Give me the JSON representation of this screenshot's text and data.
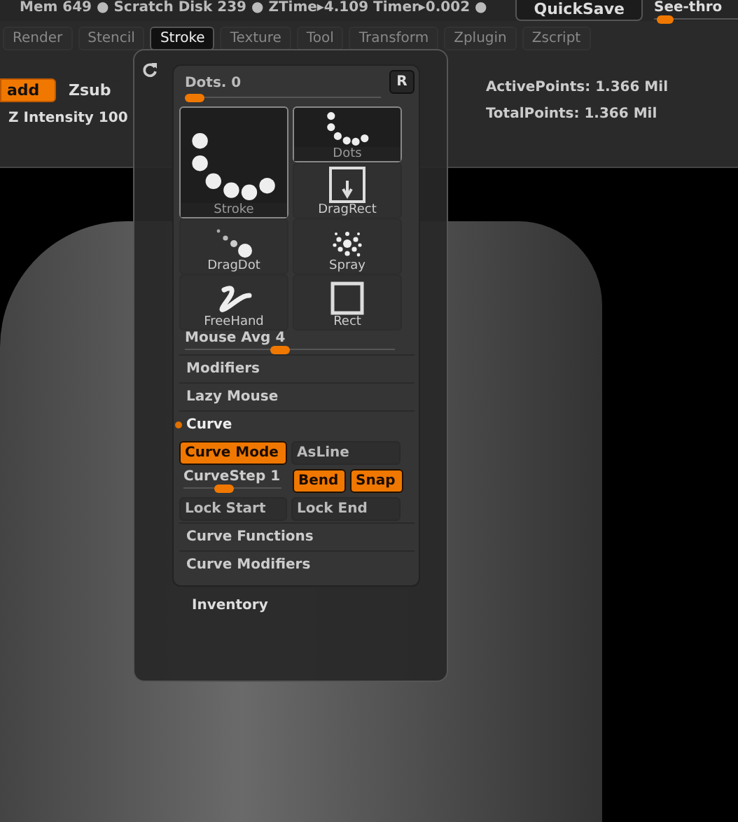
{
  "status_bar": {
    "text": "Mem 649 ● Scratch Disk 239 ●  ZTime▸4.109 Timer▸0.002 ●",
    "quicksave": "QuickSave",
    "see_through": {
      "label": "See-thro",
      "level": 0.05
    }
  },
  "tabs": [
    {
      "label": "Render",
      "selected": false
    },
    {
      "label": "Stencil",
      "selected": false
    },
    {
      "label": "Stroke",
      "selected": true
    },
    {
      "label": "Texture",
      "selected": false
    },
    {
      "label": "Tool",
      "selected": false
    },
    {
      "label": "Transform",
      "selected": false
    },
    {
      "label": "Zplugin",
      "selected": false
    },
    {
      "label": "Zscript",
      "selected": false
    }
  ],
  "toolbar": {
    "modes": [
      {
        "label": "add",
        "selected": true
      },
      {
        "label": "Zsub",
        "selected": false
      }
    ],
    "z_intensity": {
      "label": "Z Intensity 100"
    }
  },
  "stats": [
    "ActivePoints: 1.366 Mil",
    "TotalPoints: 1.366 Mil"
  ],
  "stroke_palette": {
    "title": "Dots. 0",
    "level": 0,
    "reset": "R",
    "preview": {
      "label": "Stroke",
      "kind": "dots"
    },
    "strokes": [
      {
        "label": "Dots",
        "kind": "dots",
        "selected": true
      },
      {
        "label": "DragRect",
        "kind": "dragrect",
        "selected": false
      },
      {
        "label": "DragDot",
        "kind": "dragdot",
        "selected": false
      },
      {
        "label": "Spray",
        "kind": "spray",
        "selected": false
      },
      {
        "label": "FreeHand",
        "kind": "freehand",
        "selected": false
      },
      {
        "label": "Rect",
        "kind": "rect",
        "selected": false
      }
    ],
    "mouse_avg": {
      "label": "Mouse Avg 4",
      "level": 0.45
    },
    "sections_before": [
      {
        "label": "Modifiers",
        "expanded": false
      },
      {
        "label": "Lazy Mouse",
        "expanded": false
      },
      {
        "label": "Curve",
        "expanded": true
      }
    ],
    "curve": {
      "curve_mode": {
        "label": "Curve Mode",
        "on": true
      },
      "as_line": {
        "label": "AsLine",
        "on": false
      },
      "curve_step": {
        "label": "CurveStep 1",
        "level": 0.4
      },
      "bend": {
        "label": "Bend",
        "on": true
      },
      "snap": {
        "label": "Snap",
        "on": true
      },
      "lock_start": {
        "label": "Lock Start",
        "on": false
      },
      "lock_end": {
        "label": "Lock End",
        "on": false
      }
    },
    "sections_after": [
      {
        "label": "Curve Functions",
        "expanded": false
      },
      {
        "label": "Curve Modifiers",
        "expanded": false
      }
    ]
  },
  "inventory": "Inventory"
}
